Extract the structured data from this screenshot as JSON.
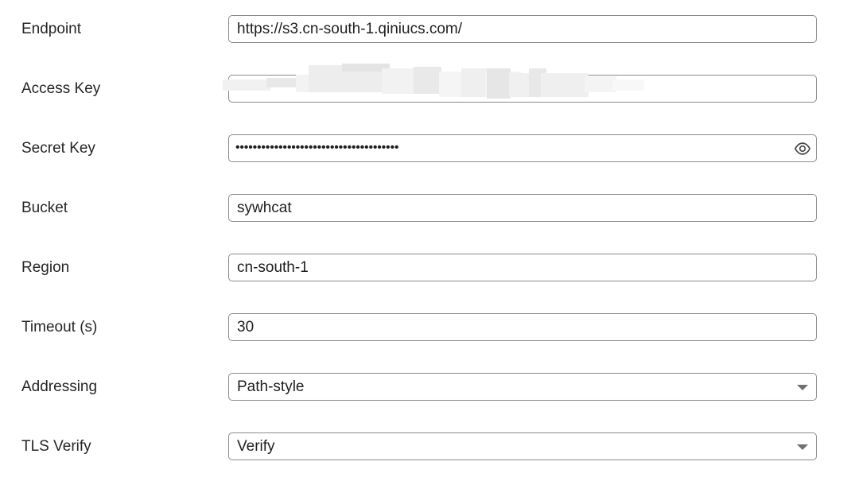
{
  "form": {
    "endpoint": {
      "label": "Endpoint",
      "value": "https://s3.cn-south-1.qiniucs.com/"
    },
    "access_key": {
      "label": "Access Key",
      "value": ""
    },
    "secret_key": {
      "label": "Secret Key",
      "masked_value": "••••••••••••••••••••••••••••••••••••••",
      "toggle_icon": "eye-icon"
    },
    "bucket": {
      "label": "Bucket",
      "value": "sywhcat"
    },
    "region": {
      "label": "Region",
      "value": "cn-south-1"
    },
    "timeout": {
      "label": "Timeout (s)",
      "value": "30"
    },
    "addressing": {
      "label": "Addressing",
      "selected": "Path-style",
      "icon": "chevron-down-icon"
    },
    "tls_verify": {
      "label": "TLS Verify",
      "selected": "Verify",
      "icon": "chevron-down-icon"
    }
  },
  "colors": {
    "border": "#8a8a8a",
    "label_text": "#262626",
    "value_text": "#1f1f1f",
    "arrow": "#707070"
  }
}
